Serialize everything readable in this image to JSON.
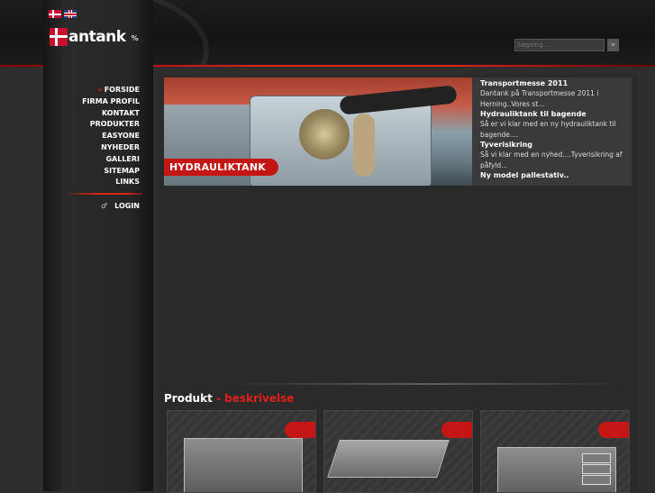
{
  "header": {
    "languages": [
      "dk-flag-icon",
      "uk-flag-icon"
    ],
    "logo": {
      "cross_icon": "danish-cross-icon",
      "text": "antank",
      "suffix": "%"
    },
    "search": {
      "placeholder": "Søgning ...",
      "button_icon": "arrow-right-icon"
    }
  },
  "nav": {
    "items": [
      {
        "label": "FORSIDE",
        "active": true
      },
      {
        "label": "FIRMA PROFIL"
      },
      {
        "label": "KONTAKT"
      },
      {
        "label": "PRODUKTER"
      },
      {
        "label": "EASYONE"
      },
      {
        "label": "NYHEDER"
      },
      {
        "label": "GALLERI"
      },
      {
        "label": "SITEMAP"
      },
      {
        "label": "LINKS"
      }
    ],
    "active_marker": "»",
    "login": {
      "icon": "key-icon",
      "label": "LOGIN"
    }
  },
  "banner": {
    "label": "HYDRAULIKTANK"
  },
  "news": [
    {
      "title": "Transportmesse 2011",
      "body": "Dantank på Transportmesse 2011 i Herning..Vores st..."
    },
    {
      "title": "Hydrauliktank til bagende",
      "body": "Så er vi klar med en ny hydrauliktank til bagende...."
    },
    {
      "title": "Tyverisikring",
      "body": "Så vi klar med en nyhed....Tyverisikring af påfyld..."
    },
    {
      "title": "Ny model pallestativ..",
      "body": ""
    }
  ],
  "section": {
    "title_a": "Produkt",
    "separator": " - ",
    "title_b": "beskrivelse"
  },
  "colors": {
    "accent_red": "#e0201a",
    "background": "#2e2e2e",
    "panel": "#262626"
  }
}
